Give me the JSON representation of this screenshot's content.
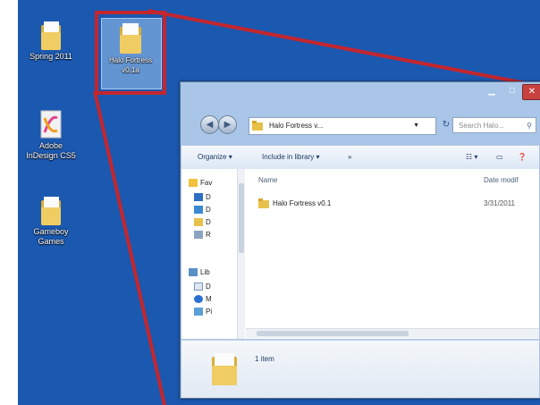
{
  "desktop": {
    "icons": [
      {
        "label": "Spring 2011"
      },
      {
        "label": "Halo Fortress v0.1a"
      },
      {
        "label": "Adobe InDesign CS5"
      },
      {
        "label": "Gameboy Games"
      }
    ]
  },
  "window": {
    "address_path": "Halo Fortress v...",
    "search_placeholder": "Search Halo...",
    "toolbar": {
      "organize": "Organize",
      "include_in_library": "Include in library"
    },
    "nav": {
      "favorites": "Fav",
      "fav_items": [
        "D",
        "D",
        "D",
        "R"
      ],
      "libraries": "Lib",
      "lib_items": [
        "D",
        "M",
        "Pi"
      ]
    },
    "columns": {
      "name": "Name",
      "date_modified": "Date modif"
    },
    "files": [
      {
        "name": "Halo Fortress v0.1",
        "date": "3/31/2011"
      }
    ],
    "details": {
      "item_count": "1 item"
    }
  },
  "colors": {
    "desktop_bg": "#1b58b0",
    "callout_red": "#c4262e",
    "folder_yellow": "#e8c14a"
  }
}
